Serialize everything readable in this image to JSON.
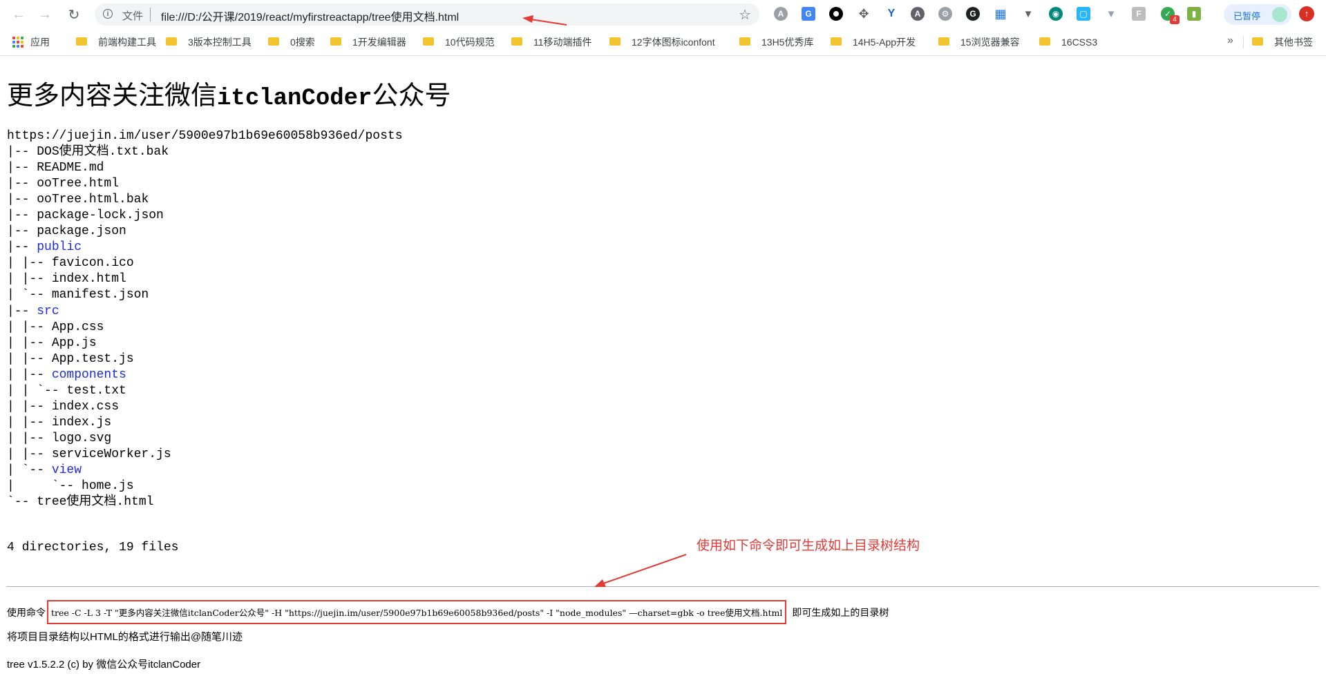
{
  "toolbar": {
    "scheme_label": "文件",
    "url": "file:///D:/公开课/2019/react/myfirstreactapp/tree使用文档.html",
    "extension_badge": "4",
    "profile_status": "已暂停"
  },
  "bookmarks": {
    "apps_label": "应用",
    "items": [
      "前端构建工具",
      "3版本控制工具",
      "0搜索",
      "1开发编辑器",
      "10代码规范",
      "11移动端插件",
      "12字体图标iconfont",
      "13H5优秀库",
      "14H5-App开发",
      "15浏览器兼容",
      "16CSS3"
    ],
    "more": "»",
    "other": "其他书签"
  },
  "page": {
    "title_prefix": "更多内容关注微信",
    "title_mono": "itclanCoder",
    "title_suffix": "公众号",
    "tree_lines": [
      {
        "prefix": "https://juejin.im/user/5900e97b1b69e60058b936ed/posts",
        "name": "",
        "dir": false
      },
      {
        "prefix": "|-- ",
        "name": "DOS使用文档.txt.bak",
        "dir": false
      },
      {
        "prefix": "|-- ",
        "name": "README.md",
        "dir": false
      },
      {
        "prefix": "|-- ",
        "name": "ooTree.html",
        "dir": false
      },
      {
        "prefix": "|-- ",
        "name": "ooTree.html.bak",
        "dir": false
      },
      {
        "prefix": "|-- ",
        "name": "package-lock.json",
        "dir": false
      },
      {
        "prefix": "|-- ",
        "name": "package.json",
        "dir": false
      },
      {
        "prefix": "|-- ",
        "name": "public",
        "dir": true
      },
      {
        "prefix": "| |-- ",
        "name": "favicon.ico",
        "dir": false
      },
      {
        "prefix": "| |-- ",
        "name": "index.html",
        "dir": false
      },
      {
        "prefix": "| `-- ",
        "name": "manifest.json",
        "dir": false
      },
      {
        "prefix": "|-- ",
        "name": "src",
        "dir": true
      },
      {
        "prefix": "| |-- ",
        "name": "App.css",
        "dir": false
      },
      {
        "prefix": "| |-- ",
        "name": "App.js",
        "dir": false
      },
      {
        "prefix": "| |-- ",
        "name": "App.test.js",
        "dir": false
      },
      {
        "prefix": "| |-- ",
        "name": "components",
        "dir": true
      },
      {
        "prefix": "| | `-- ",
        "name": "test.txt",
        "dir": false
      },
      {
        "prefix": "| |-- ",
        "name": "index.css",
        "dir": false
      },
      {
        "prefix": "| |-- ",
        "name": "index.js",
        "dir": false
      },
      {
        "prefix": "| |-- ",
        "name": "logo.svg",
        "dir": false
      },
      {
        "prefix": "| |-- ",
        "name": "serviceWorker.js",
        "dir": false
      },
      {
        "prefix": "| `-- ",
        "name": "view",
        "dir": true
      },
      {
        "prefix": "|     `-- ",
        "name": "home.js",
        "dir": false
      },
      {
        "prefix": "`-- ",
        "name": "tree使用文档.html",
        "dir": false
      }
    ],
    "summary": "4 directories, 19 files",
    "annotation": "使用如下命令即可生成如上目录树结构",
    "command_prefix": "使用命令",
    "command": "tree -C -L 3 -T \"更多内容关注微信itclanCoder公众号\" -H \"https://juejin.im/user/5900e97b1b69e60058b936ed/posts\" -I \"node_modules\" —charset=gbk -o tree使用文档.html",
    "command_suffix": "即可生成如上的目录树",
    "description": "将项目目录结构以HTML的格式进行输出@随笔川迹",
    "version": "tree v1.5.2.2 (c) by 微信公众号itclanCoder"
  },
  "colors": {
    "directory": "#1d2be3",
    "annotation": "#e53935",
    "folder": "#f4c430"
  }
}
